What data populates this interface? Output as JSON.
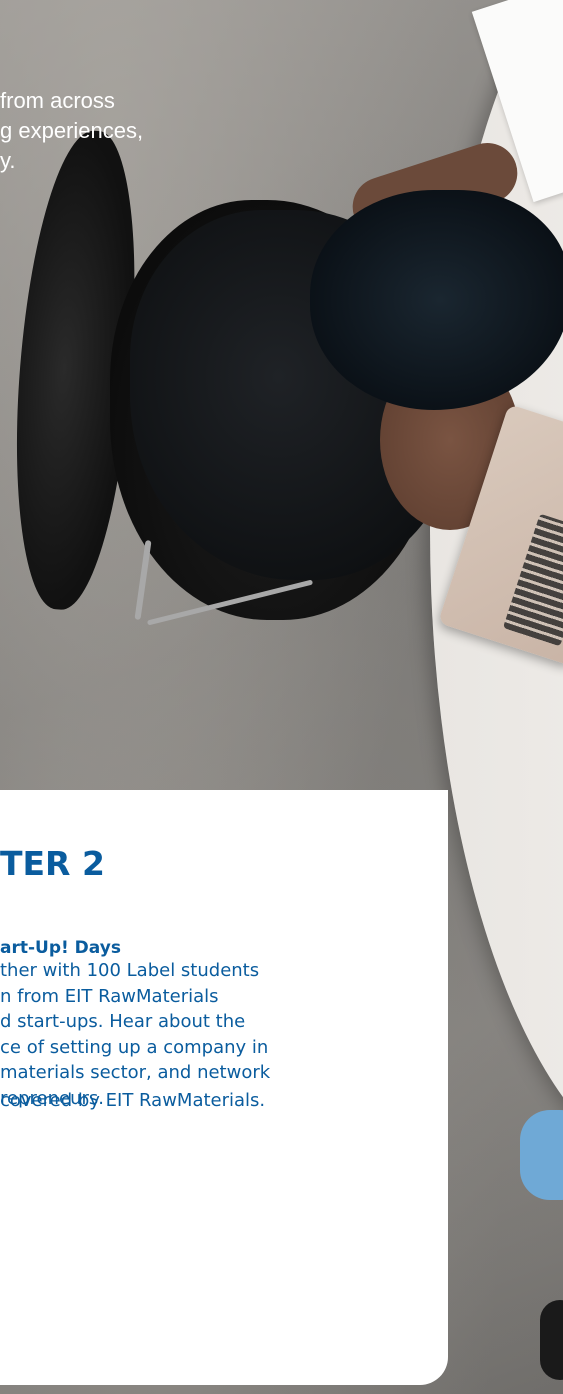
{
  "intro": {
    "lines": [
      "from across",
      "g experiences,",
      "y."
    ]
  },
  "card": {
    "title": "TER 2",
    "subtitle": "art-Up! Days",
    "body_lines": [
      "ther with 100 Label students",
      "n from EIT RawMaterials",
      "d start-ups. Hear about the",
      "ce of setting up a company in",
      "materials sector, and network",
      "repreneurs."
    ],
    "note": "covered by EIT RawMaterials.",
    "accent_color": "#0a5c9e"
  }
}
